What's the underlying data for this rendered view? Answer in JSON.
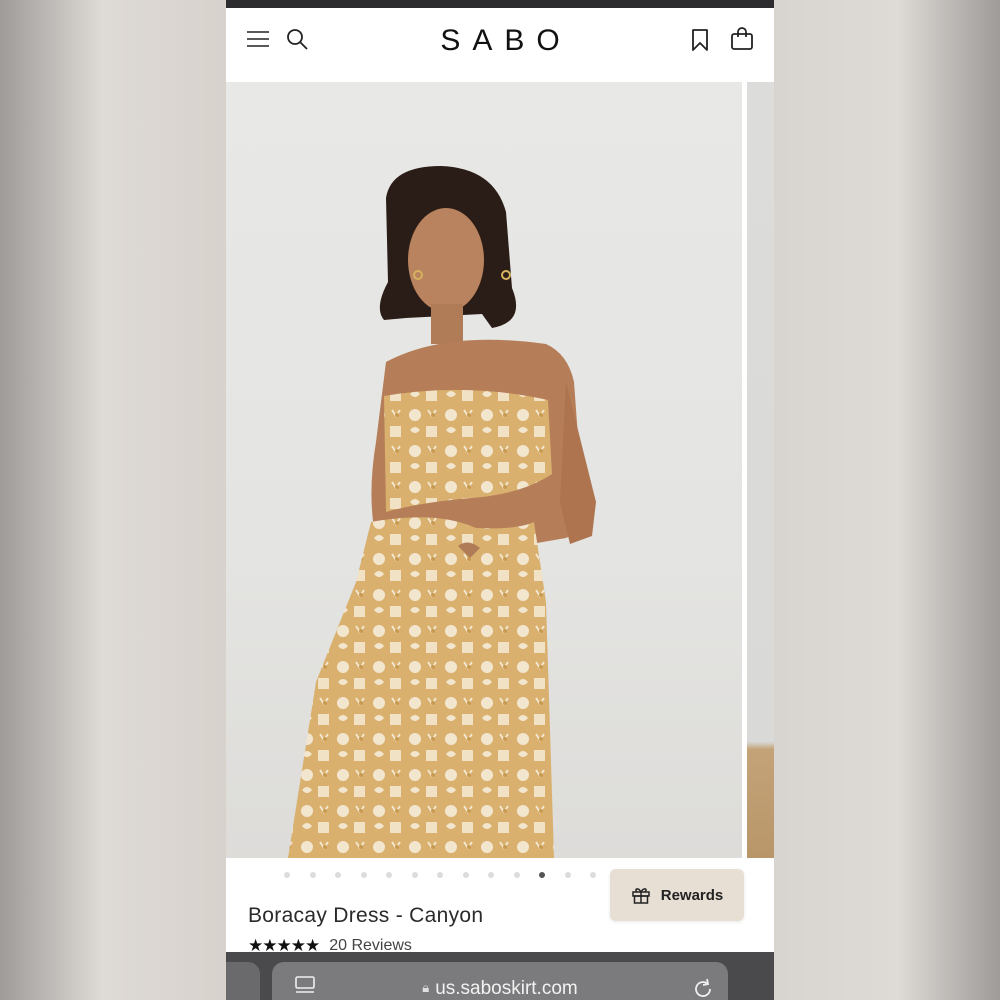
{
  "header": {
    "logo": "SABO",
    "icons": [
      "menu-icon",
      "search-icon",
      "bookmark-icon",
      "bag-icon"
    ]
  },
  "gallery": {
    "total_images": 13,
    "active_index": 10
  },
  "product": {
    "title": "Boracay Dress - Canyon",
    "stars": "★★★★★",
    "reviews": "20 Reviews"
  },
  "rewards": {
    "label": "Rewards",
    "background": "#e8dfd4"
  },
  "browser": {
    "url": "us.saboskirt.com"
  }
}
